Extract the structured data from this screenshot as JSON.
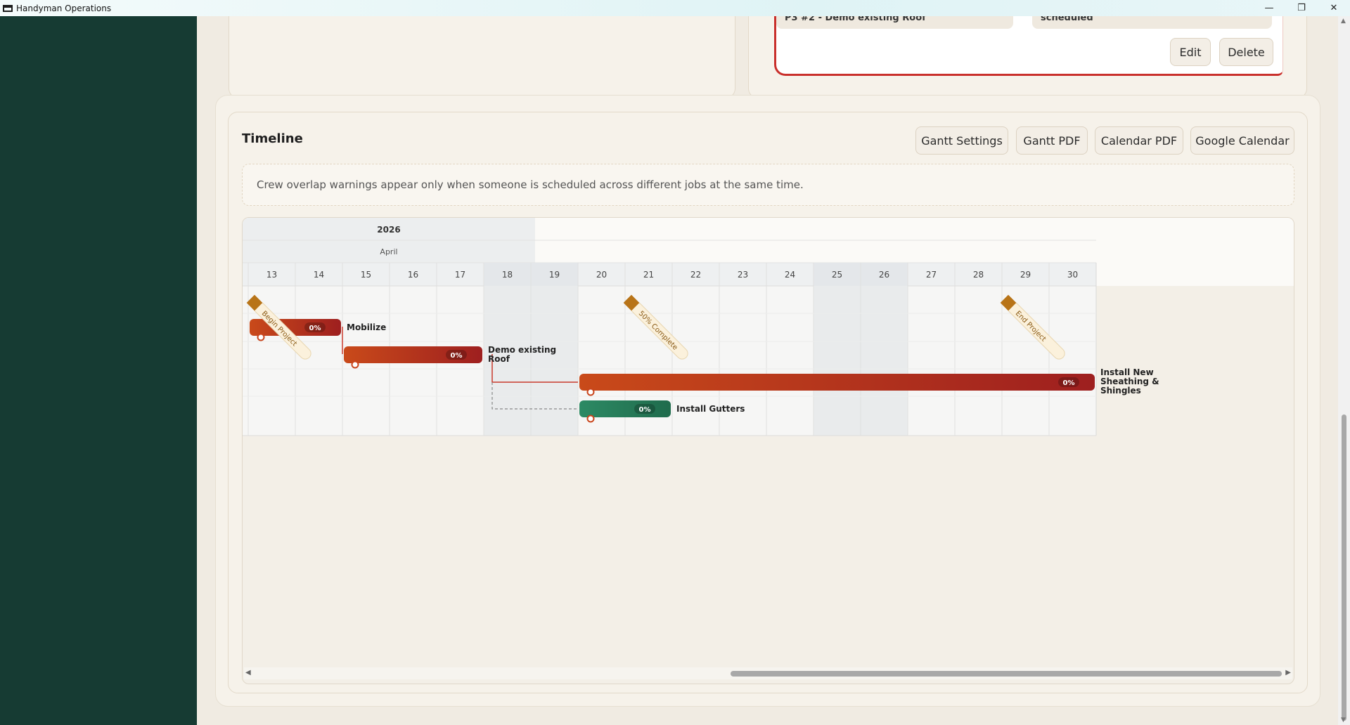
{
  "window": {
    "title": "Handyman Operations",
    "minimize": "—",
    "maximize": "❐",
    "close": "✕"
  },
  "top_card": {
    "task_field": "P3 #2 - Demo existing Roof",
    "status_field": "scheduled",
    "edit_label": "Edit",
    "delete_label": "Delete"
  },
  "timeline": {
    "title": "Timeline",
    "buttons": {
      "settings": "Gantt Settings",
      "gantt_pdf": "Gantt PDF",
      "calendar_pdf": "Calendar PDF",
      "google": "Google Calendar"
    },
    "note": "Crew overlap warnings appear only when someone is scheduled across different jobs at the same time."
  },
  "gantt": {
    "year": "2026",
    "month": "April",
    "days": [
      "13",
      "14",
      "15",
      "16",
      "17",
      "18",
      "19",
      "20",
      "21",
      "22",
      "23",
      "24",
      "25",
      "26",
      "27",
      "28",
      "29",
      "30"
    ],
    "weekend_days": [
      "18",
      "19",
      "25",
      "26"
    ],
    "milestones": [
      {
        "label": "Begin Project",
        "day": 13
      },
      {
        "label": "50% Complete",
        "day": 21
      },
      {
        "label": "End Project",
        "day": 29
      }
    ],
    "tasks": [
      {
        "name": "Mobilize",
        "start": 13,
        "end": 14,
        "progress": "0%",
        "color": "red"
      },
      {
        "name": "Demo existing Roof",
        "start": 15,
        "end": 17,
        "progress": "0%",
        "color": "red"
      },
      {
        "name": "Install New Sheathing & Shingles",
        "start": 20,
        "end": 30,
        "progress": "0%",
        "color": "red"
      },
      {
        "name": "Install Gutters",
        "start": 20,
        "end": 21,
        "progress": "0%",
        "color": "green"
      }
    ],
    "colors": {
      "red_start": "#c94a1a",
      "red_end": "#9e1f1f",
      "green_start": "#2d8a64",
      "green_end": "#1f6b4c",
      "milestone": "#b87418",
      "link": "#c93a2c"
    }
  }
}
